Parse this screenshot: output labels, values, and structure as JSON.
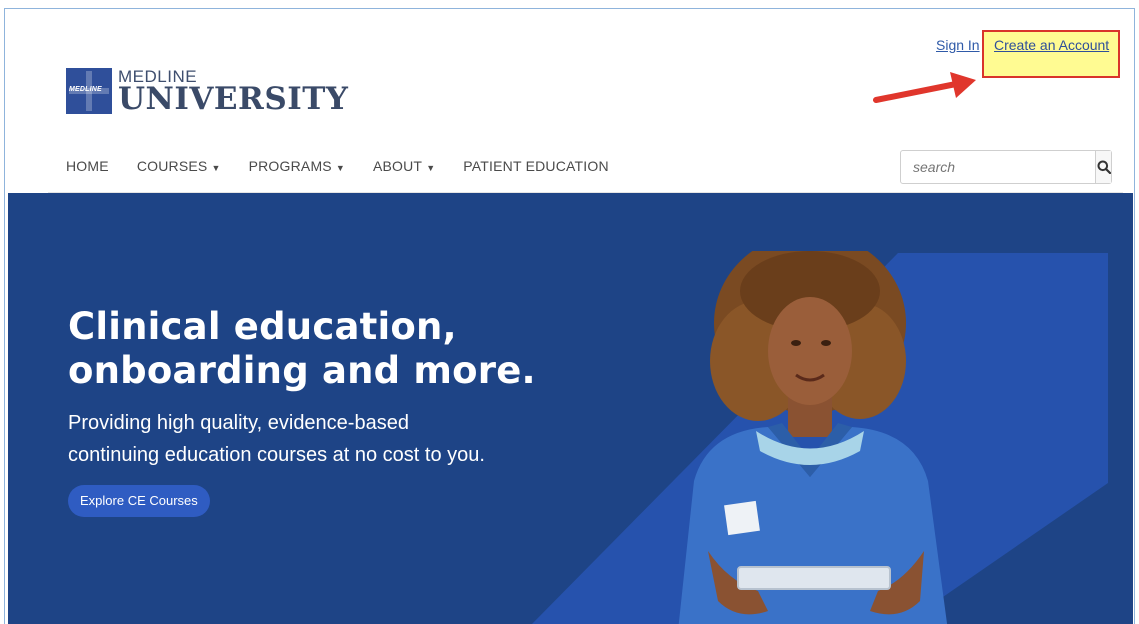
{
  "header": {
    "sign_in": "Sign In",
    "create_account": "Create an Account",
    "logo_mark_text": "MEDLINE",
    "logo_line1": "MEDLINE",
    "logo_line2": "UNIVERSITY"
  },
  "nav": {
    "items": [
      {
        "label": "HOME",
        "dropdown": false
      },
      {
        "label": "COURSES",
        "dropdown": true
      },
      {
        "label": "PROGRAMS",
        "dropdown": true
      },
      {
        "label": "ABOUT",
        "dropdown": true
      },
      {
        "label": "PATIENT EDUCATION",
        "dropdown": false
      }
    ]
  },
  "search": {
    "placeholder": "search",
    "icon": "search-icon"
  },
  "hero": {
    "headline_line1": "Clinical education,",
    "headline_line2": "onboarding and more.",
    "subtext_line1": "Providing high quality, evidence-based",
    "subtext_line2": "continuing education courses at no cost to you.",
    "cta_label": "Explore CE Courses"
  },
  "colors": {
    "hero_bg": "#1e4486",
    "stripe": "#2a56b0",
    "brand": "#2f4f9a",
    "highlight": "#fffb92",
    "annotation": "#d9342b"
  }
}
